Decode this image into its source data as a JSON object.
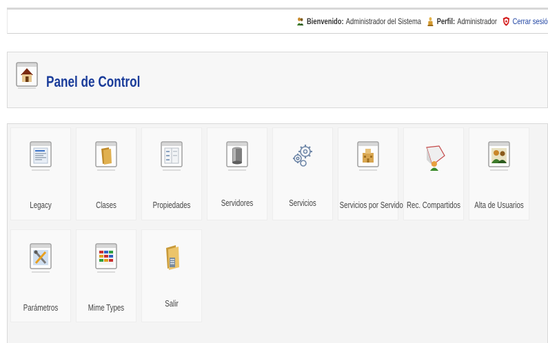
{
  "topbar": {
    "welcome_label": "Bienvenido:",
    "welcome_value": "Administrador del Sistema",
    "profile_label": "Perfil:",
    "profile_value": "Administrador",
    "logout_label": "Cerrar sesió"
  },
  "header": {
    "title": "Panel de Control",
    "icon": "house-icon"
  },
  "tiles": [
    {
      "label": "Legacy",
      "icon": "legacy-icon"
    },
    {
      "label": "Clases",
      "icon": "folder-icon"
    },
    {
      "label": "Propiedades",
      "icon": "properties-icon"
    },
    {
      "label": "Servidores",
      "icon": "server-icon"
    },
    {
      "label": "Servicios",
      "icon": "gears-icon"
    },
    {
      "label": "Servicios por Servidor",
      "icon": "server-services-icon"
    },
    {
      "label": "Rec. Compartidos",
      "icon": "shared-resources-icon"
    },
    {
      "label": "Alta de Usuarios",
      "icon": "users-icon"
    },
    {
      "label": "Parámetros",
      "icon": "tools-icon"
    },
    {
      "label": "Mime Types",
      "icon": "mime-types-icon"
    },
    {
      "label": "Salir",
      "icon": "exit-folder-icon"
    }
  ]
}
